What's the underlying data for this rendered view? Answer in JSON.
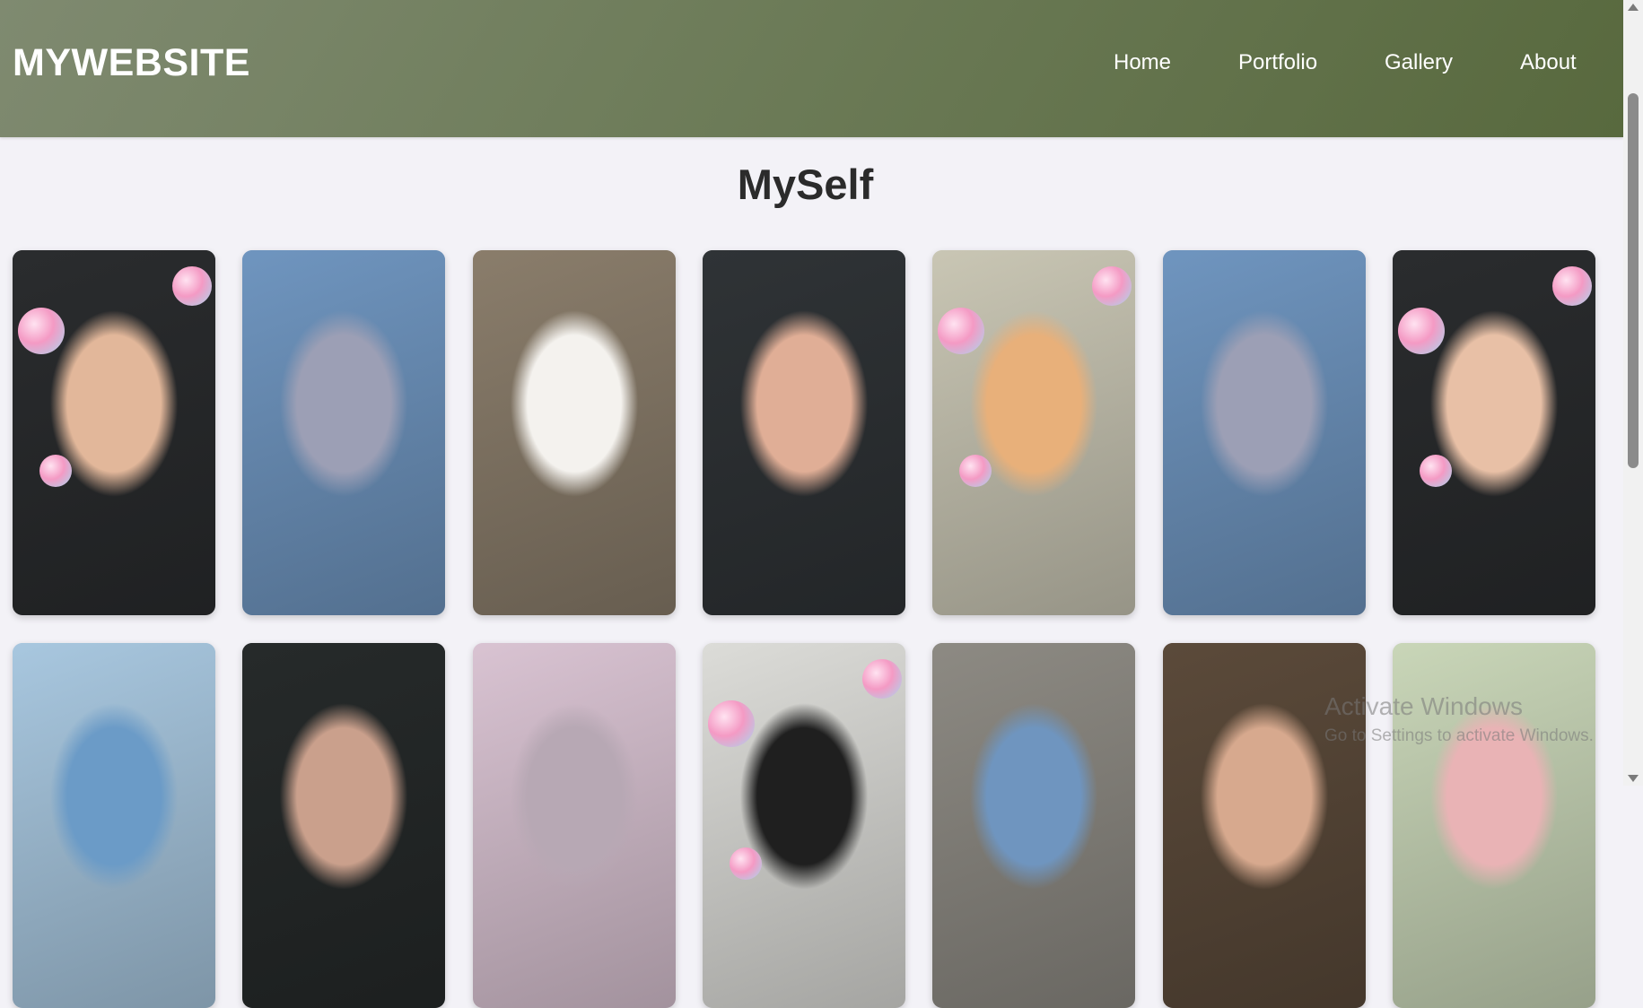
{
  "header": {
    "logo": "MYWEBSITE",
    "nav": [
      {
        "label": "Home",
        "name": "nav-home"
      },
      {
        "label": "Portfolio",
        "name": "nav-portfolio"
      },
      {
        "label": "Gallery",
        "name": "nav-gallery"
      },
      {
        "label": "About",
        "name": "nav-about"
      }
    ]
  },
  "main": {
    "title": "MySelf",
    "gallery": [
      {
        "name": "photo-selfie-hearts",
        "bg": "#2a2c2e",
        "accent": "#e2b79a"
      },
      {
        "name": "photo-blue-hoodie-rotated",
        "bg": "#6f95bf",
        "accent": "#9c9fb5"
      },
      {
        "name": "photo-white-kitten",
        "bg": "#8a7d6b",
        "accent": "#f4f2ee"
      },
      {
        "name": "photo-selfie-strawberry",
        "bg": "#2f3336",
        "accent": "#e0ae96"
      },
      {
        "name": "photo-orange-kitten",
        "bg": "#c9c6b4",
        "accent": "#e8b07a"
      },
      {
        "name": "photo-blue-hoodie-rotated-2",
        "bg": "#6f95bf",
        "accent": "#9c9fb5"
      },
      {
        "name": "photo-selfie-hearts-2",
        "bg": "#2a2c2e",
        "accent": "#e8c0a6"
      },
      {
        "name": "photo-blue-flowers",
        "bg": "#a8c7df",
        "accent": "#6b9bc7"
      },
      {
        "name": "photo-selfie-dark",
        "bg": "#262a2a",
        "accent": "#caa08c"
      },
      {
        "name": "photo-pink-palm",
        "bg": "#d9c3d2",
        "accent": "#b7a8b4"
      },
      {
        "name": "photo-pink-hearts-crown",
        "bg": "#dcdcd8",
        "accent": "#1f1f1f"
      },
      {
        "name": "photo-room-blue",
        "bg": "#8d8a83",
        "accent": "#6f95bf"
      },
      {
        "name": "photo-selfie-closeup",
        "bg": "#5b4a3a",
        "accent": "#d7a98e"
      },
      {
        "name": "photo-flower-vines",
        "bg": "#c9d6b8",
        "accent": "#e9b3b5"
      }
    ]
  },
  "watermark": {
    "line1": "Activate Windows",
    "line2": "Go to Settings to activate Windows."
  },
  "colors": {
    "header_start": "#7f8a70",
    "header_end": "#58693e",
    "page_bg": "#f3f2f7"
  }
}
